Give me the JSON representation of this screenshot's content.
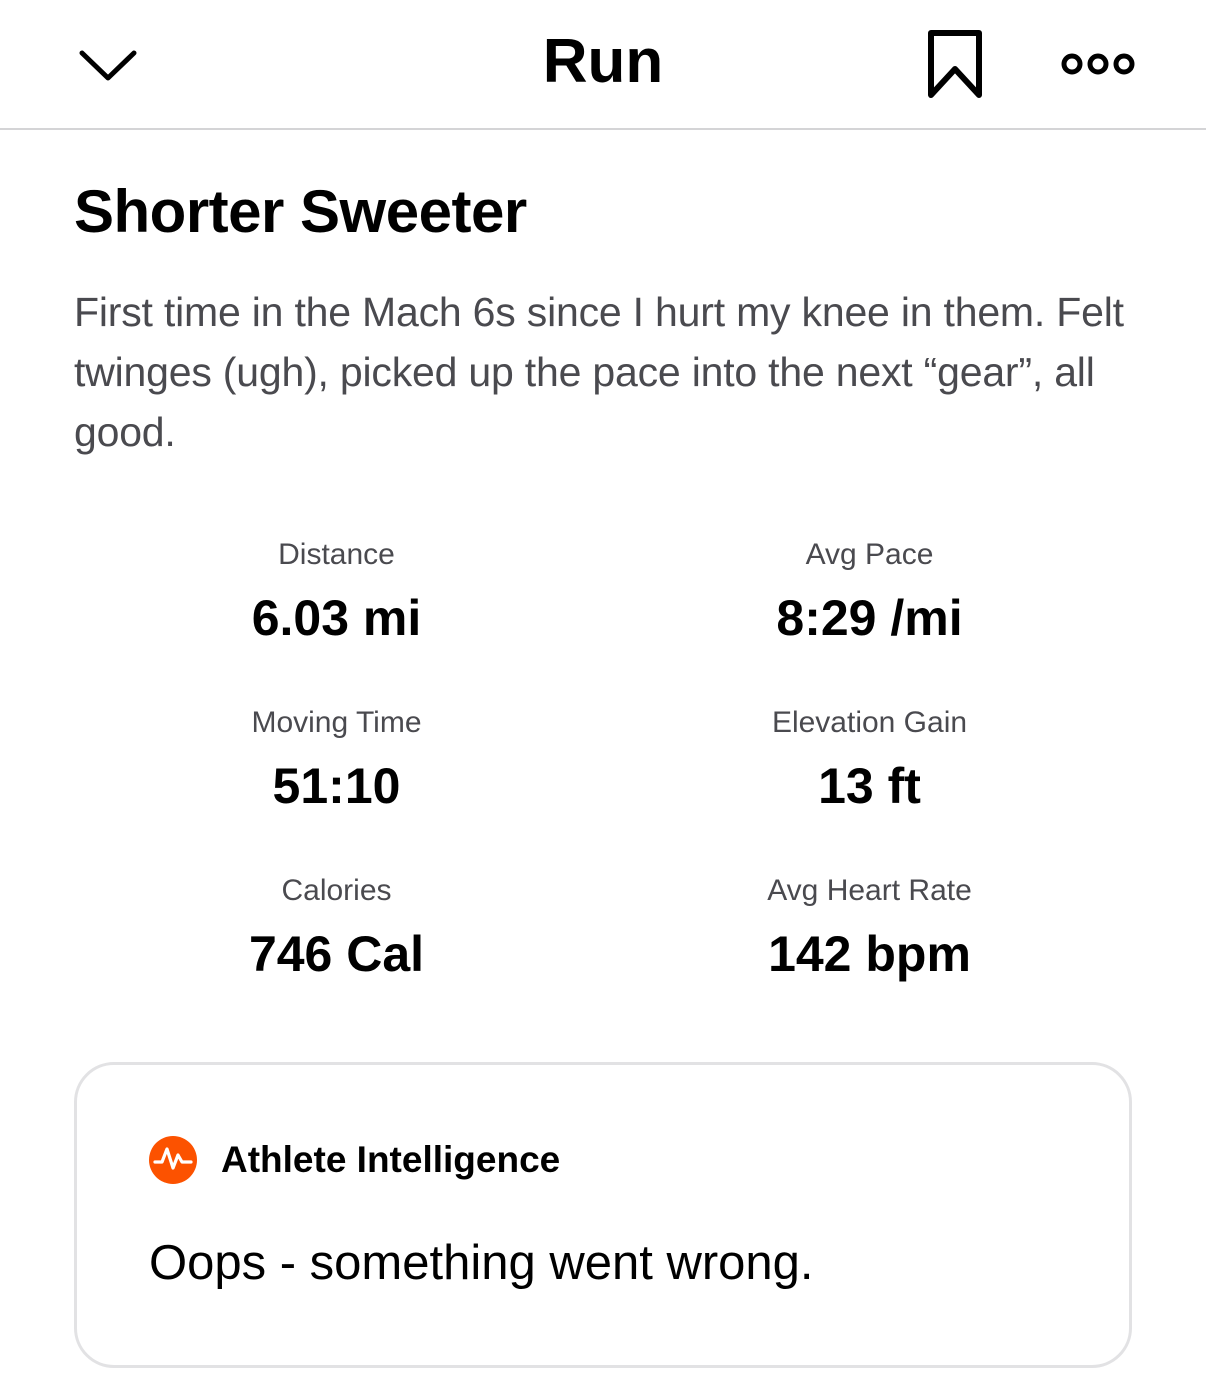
{
  "header": {
    "title": "Run",
    "back_icon": "chevron-down-icon",
    "save_icon": "bookmark-icon",
    "more_icon": "more-options-icon"
  },
  "activity": {
    "title": "Shorter Sweeter",
    "description": "First time in the Mach 6s since I hurt my knee in them. Felt twinges (ugh), picked up the pace into the next “gear”, all good."
  },
  "stats": [
    {
      "label": "Distance",
      "value": "6.03 mi"
    },
    {
      "label": "Avg Pace",
      "value": "8:29 /mi"
    },
    {
      "label": "Moving Time",
      "value": "51:10"
    },
    {
      "label": "Elevation Gain",
      "value": "13 ft"
    },
    {
      "label": "Calories",
      "value": "746 Cal"
    },
    {
      "label": "Avg Heart Rate",
      "value": "142 bpm"
    }
  ],
  "athlete_intelligence": {
    "title": "Athlete Intelligence",
    "message": "Oops - something went wrong.",
    "icon": "strava-logo-icon",
    "accent_color": "#fc5200"
  }
}
